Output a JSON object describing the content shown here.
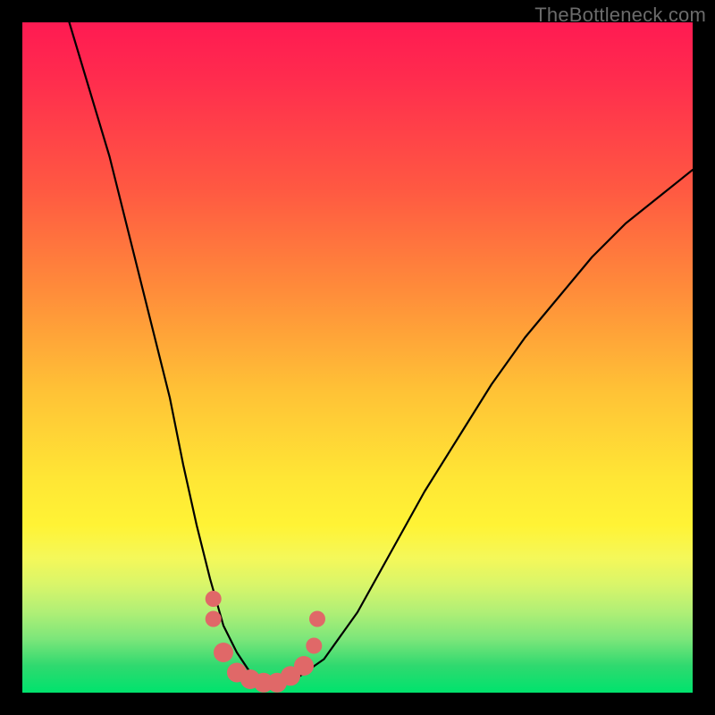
{
  "watermark": "TheBottleneck.com",
  "chart_data": {
    "type": "line",
    "title": "",
    "xlabel": "",
    "ylabel": "",
    "xlim": [
      0,
      100
    ],
    "ylim": [
      0,
      100
    ],
    "series": [
      {
        "name": "curve",
        "x": [
          7,
          10,
          13,
          16,
          19,
          22,
          24,
          26,
          28,
          30,
          32,
          34,
          36,
          38,
          40,
          45,
          50,
          55,
          60,
          65,
          70,
          75,
          80,
          85,
          90,
          95,
          100
        ],
        "values": [
          100,
          90,
          80,
          68,
          56,
          44,
          34,
          25,
          17,
          10,
          6,
          3,
          1.5,
          1,
          1.5,
          5,
          12,
          21,
          30,
          38,
          46,
          53,
          59,
          65,
          70,
          74,
          78
        ]
      }
    ],
    "markers": {
      "name": "valley-points",
      "color": "#e06868",
      "size_small": 9,
      "size_large": 11,
      "points": [
        {
          "x": 28.5,
          "y": 14,
          "r": "small"
        },
        {
          "x": 28.5,
          "y": 11,
          "r": "small"
        },
        {
          "x": 30.0,
          "y": 6,
          "r": "large"
        },
        {
          "x": 32.0,
          "y": 3,
          "r": "large"
        },
        {
          "x": 34.0,
          "y": 2,
          "r": "large"
        },
        {
          "x": 36.0,
          "y": 1.5,
          "r": "large"
        },
        {
          "x": 38.0,
          "y": 1.5,
          "r": "large"
        },
        {
          "x": 40.0,
          "y": 2.5,
          "r": "large"
        },
        {
          "x": 42.0,
          "y": 4,
          "r": "large"
        },
        {
          "x": 43.5,
          "y": 7,
          "r": "small"
        },
        {
          "x": 44.0,
          "y": 11,
          "r": "small"
        }
      ]
    }
  }
}
